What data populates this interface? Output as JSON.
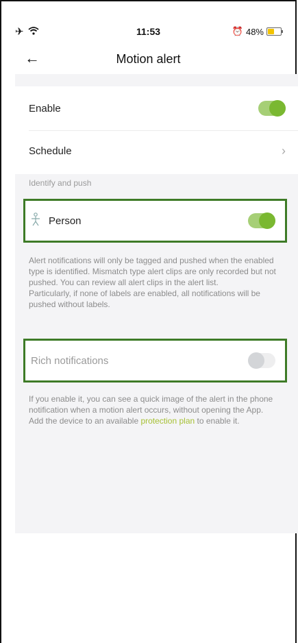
{
  "status_bar": {
    "left_icons": [
      "airplane-icon",
      "wifi-icon"
    ],
    "time": "11:53",
    "right_icon": "alarm-icon",
    "battery": "48%",
    "battery_level": 0.48
  },
  "nav": {
    "back_icon": "arrow-left-icon",
    "title": "Motion alert"
  },
  "settings": {
    "enable_label": "Enable",
    "enable_on": true,
    "schedule_label": "Schedule",
    "section_label": "Identify and push",
    "person_label": "Person",
    "person_on": true,
    "person_description": [
      "Alert notifications will only be tagged and pushed when the enabled type is identified. Mismatch type alert clips are only recorded but not pushed. You can review all alert clips in the alert list.",
      "Particularly, if none of labels are enabled, all notifications will be pushed without labels."
    ],
    "rich_label": "Rich notifications",
    "rich_on": false,
    "rich_description": "If you enable it, you can see a quick image of the alert in the phone notification when a motion alert occurs, without opening the App.",
    "plan_prefix": "Add the device to an available ",
    "plan_link": "protection plan",
    "plan_suffix": " to enable it."
  },
  "colors": {
    "accent_green": "#7ab831",
    "highlight_border": "#3e7b27",
    "link_color": "#a6c034"
  }
}
